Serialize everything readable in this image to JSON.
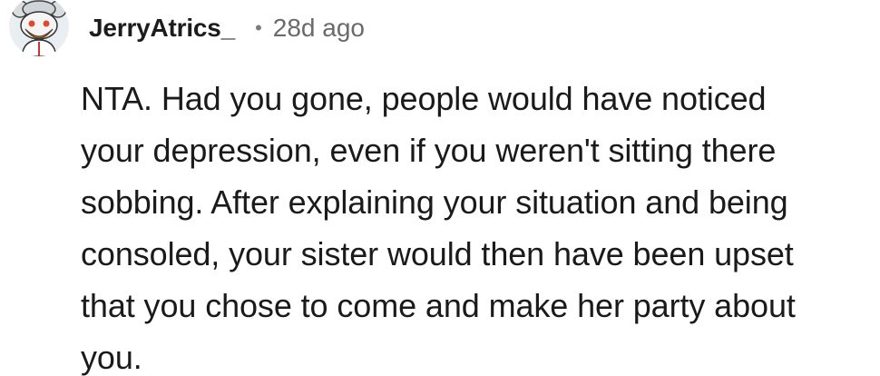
{
  "comment": {
    "author": "JerryAtrics_",
    "separator": "•",
    "age": "28d ago",
    "avatar_icon": "snoo-avatar-icon",
    "body": "NTA. Had you gone, people would have noticed\nyour depression, even if you weren't sitting there\nsobbing. After explaining your situation and being\nconsoled, your sister would then have been upset\nthat you chose to come and make her party about\nyou."
  },
  "colors": {
    "background": "#ffffff",
    "text": "#1a1a1a",
    "meta": "#6a6a6a",
    "avatar_bg": "#e9eef2"
  }
}
